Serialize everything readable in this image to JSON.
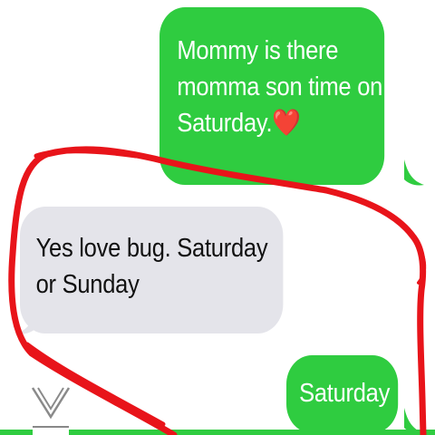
{
  "messages": [
    {
      "direction": "sent",
      "lines": [
        "Mommy is there",
        "momma son time on",
        "Saturday."
      ],
      "emoji": "❤️"
    },
    {
      "direction": "received",
      "lines": [
        "Yes love bug. Saturday",
        "or Sunday"
      ]
    },
    {
      "direction": "sent",
      "lines": [
        "Saturday"
      ]
    }
  ],
  "colors": {
    "sent_bubble": "#2fcc40",
    "received_bubble": "#e4e4ea",
    "annotation_stroke": "#e8141a"
  },
  "icons": {
    "scroll_chevron": "chevron-down-icon",
    "emoji_heart": "heart-emoji-icon"
  }
}
